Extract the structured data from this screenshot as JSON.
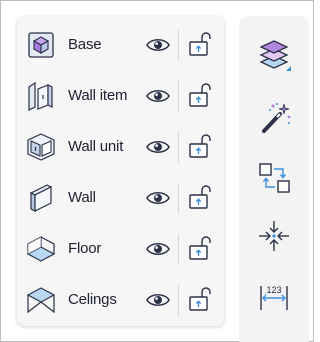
{
  "layers": [
    {
      "name": "Base",
      "icon": "base-cube-icon"
    },
    {
      "name": "Wall item",
      "icon": "wall-item-icon"
    },
    {
      "name": "Wall unit",
      "icon": "wall-unit-icon"
    },
    {
      "name": "Wall",
      "icon": "wall-icon"
    },
    {
      "name": "Floor",
      "icon": "floor-icon"
    },
    {
      "name": "Celings",
      "icon": "ceiling-icon"
    }
  ],
  "tools": [
    {
      "name": "layers-tool",
      "icon": "layers-stack-icon",
      "has_dropdown": true
    },
    {
      "name": "magic-wand-tool",
      "icon": "magic-wand-icon"
    },
    {
      "name": "connect-tool",
      "icon": "connect-squares-icon"
    },
    {
      "name": "compress-tool",
      "icon": "compress-arrows-icon"
    },
    {
      "name": "measure-tool",
      "icon": "measure-ruler-icon",
      "label": "123"
    }
  ],
  "colors": {
    "accent": "#3d8fe0",
    "icon_stroke": "#2b3146",
    "layers_fill": "#b287e0",
    "layers_fill_light": "#b9d7f2"
  }
}
